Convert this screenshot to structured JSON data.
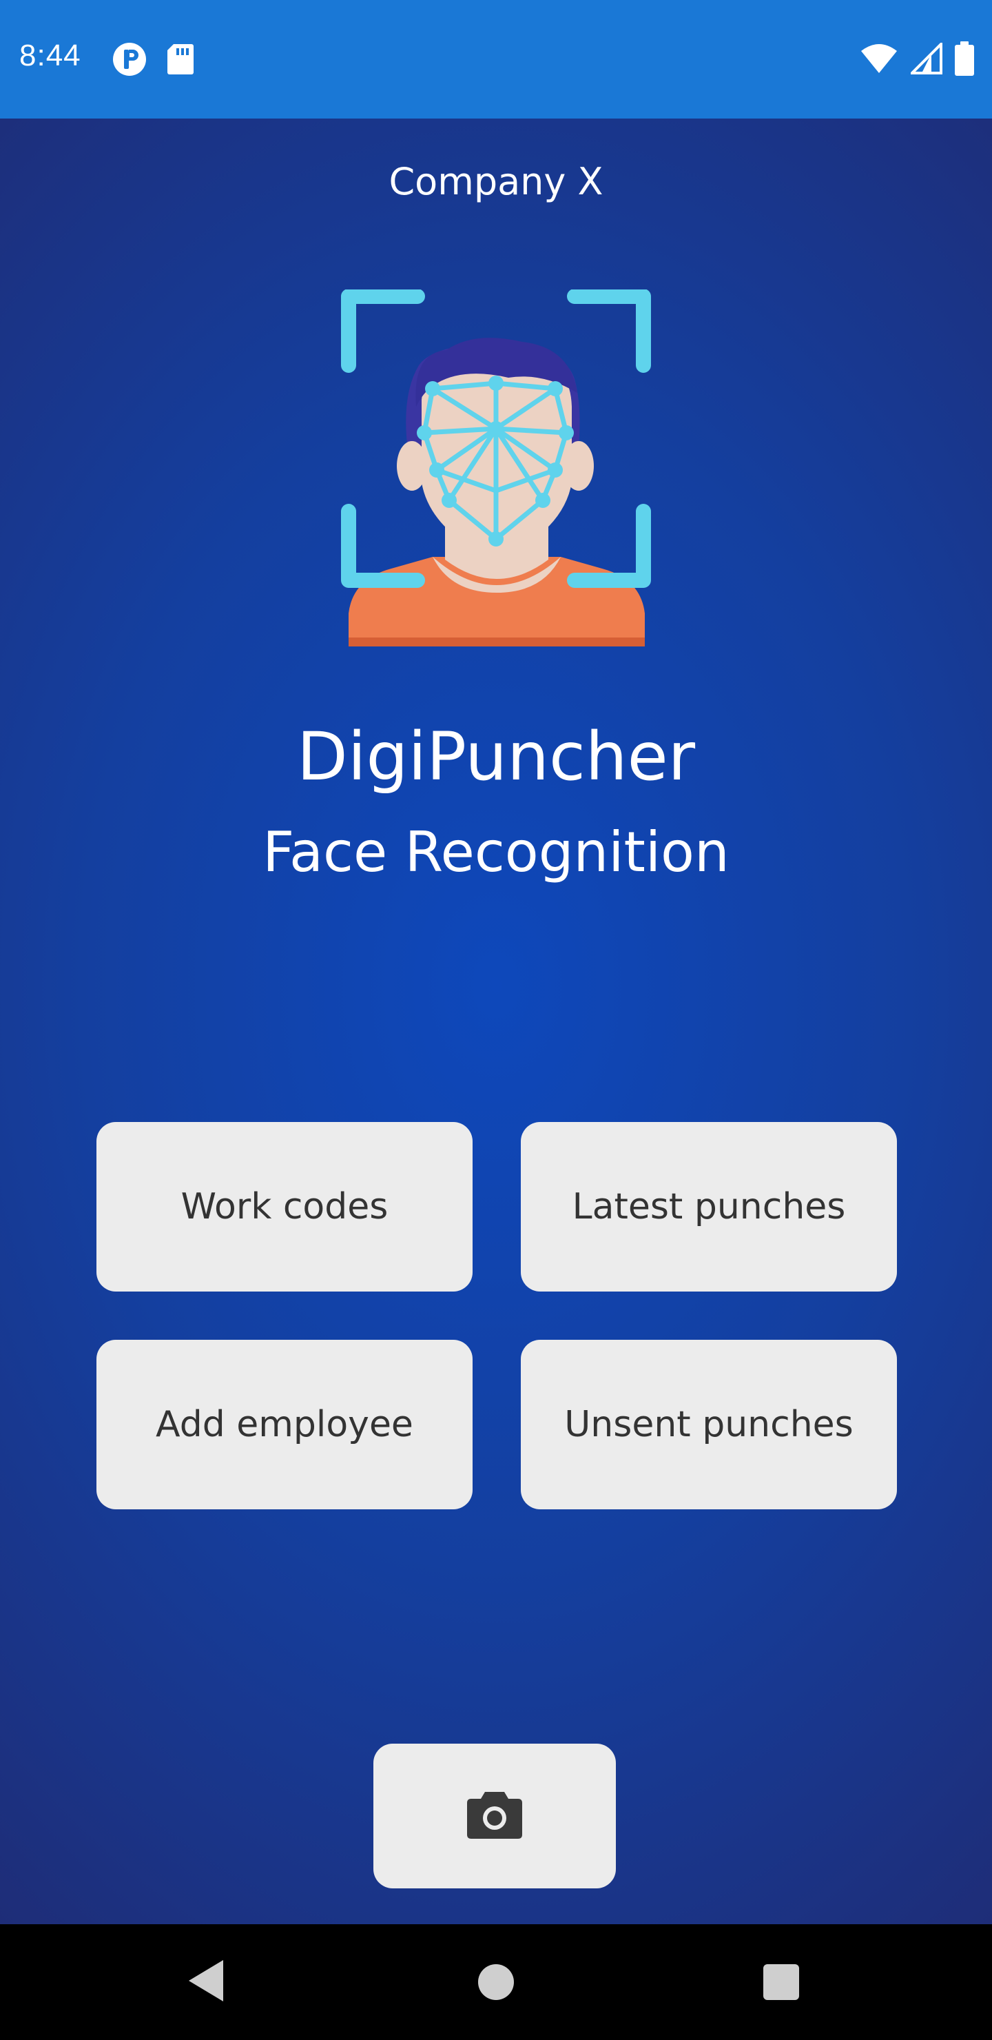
{
  "status_bar": {
    "time": "8:44",
    "left_icons": [
      "notification-p-icon",
      "sd-card-icon"
    ],
    "right_icons": [
      "wifi-icon",
      "cell-signal-icon",
      "battery-icon"
    ],
    "background_color": "#1a78d6"
  },
  "header": {
    "company": "Company X"
  },
  "branding": {
    "title": "DigiPuncher",
    "subtitle": "Face Recognition",
    "illustration_icon": "face-scan-icon"
  },
  "menu": {
    "work_codes": "Work codes",
    "latest_punches": "Latest punches",
    "add_employee": "Add employee",
    "unsent_punches": "Unsent punches"
  },
  "camera_button": {
    "icon": "camera-icon"
  },
  "nav_bar": {
    "icons": [
      "back-icon",
      "home-icon",
      "recents-icon"
    ]
  },
  "colors": {
    "accent_cyan": "#5fd3ec",
    "button_background": "#ececec",
    "shirt_orange": "#ef7d4e",
    "hair_purple": "#3a35a2"
  }
}
